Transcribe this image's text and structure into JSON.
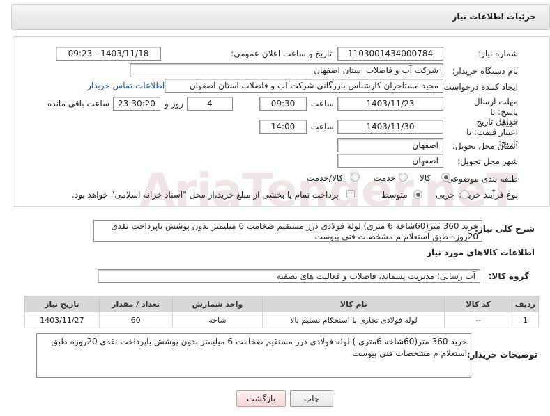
{
  "header": {
    "title": "جزئیات اطلاعات نیاز"
  },
  "watermark": "AriaTender.neT",
  "form": {
    "need_number_label": "شماره نیاز:",
    "need_number": "1103001434000784",
    "announce_label": "تاریخ و ساعت اعلان عمومی:",
    "announce_value": "1403/11/18 - 09:23",
    "buyer_org_label": "نام دستگاه خریدار:",
    "buyer_org": "شرکت آب و فاضلاب استان اصفهان",
    "creator_label": "ایجاد کننده درخواست:",
    "creator": "مجید مستاجران کارشناس بازرگانی شرکت آب و فاضلاب استان اصفهان",
    "contact_link": "اطلاعات تماس خریدار",
    "deadline_label": "مهلت ارسال پاسخ: تا تاریخ:",
    "deadline_date": "1403/11/23",
    "time_label": "ساعت",
    "deadline_time": "09:30",
    "days_value": "4",
    "days_label": "روز و",
    "remaining_time": "23:30:20",
    "remaining_label": "ساعت باقی مانده",
    "validity_label": "حداقل تاریخ اعتبار قیمت: تا تاریخ:",
    "validity_date": "1403/11/30",
    "validity_time": "14:00",
    "province_label": "استان محل تحویل:",
    "province": "اصفهان",
    "city_label": "شهر محل تحویل:",
    "city": "اصفهان",
    "category_label": "طبقه بندی موضوعی:",
    "category_options": [
      "کالا",
      "خدمت",
      "کالا/خدمت"
    ],
    "process_label": "نوع فرآیند خرید :",
    "process_options": [
      "جزیی",
      "متوسط"
    ],
    "payment_text": "پرداخت تمام یا بخشی از مبلغ خرید،از محل \"اسناد خزانه اسلامی\" خواهد بود."
  },
  "summary": {
    "label": "شرح کلی نیاز:",
    "text": "خرید 360 متر(60شاخه 6 متری) لوله فولادی درز مستقیم ضخامت 6 میلیمتر بدون پوشش باپرداخت نقدی 20روزه طبق استعلام م مشخصات فنی پیوست"
  },
  "goods": {
    "section_title": "اطلاعات کالاهای مورد نیاز",
    "group_label": "گروه کالا:",
    "group_value": "آب رسانی؛ مدیریت پسماند، فاضلاب و فعالیت های تصفیه",
    "columns": [
      "ردیف",
      "کد کالا",
      "نام کالا",
      "واحد شمارش",
      "تعداد / مقدار",
      "تاریخ نیاز"
    ],
    "rows": [
      [
        "1",
        "--",
        "لوله فولادی تجاری با استحکام تسلیم بالا",
        "شاخه",
        "60",
        "1403/11/27"
      ]
    ]
  },
  "buyer_notes": {
    "label": "توضیحات خریدار:",
    "text": "خرید 360 متر(60شاخه 6متری ) لوله فولادی درز مستقیم ضخامت 6 میلیمتر بدون پوشش باپرداخت نقدی 20روزه طبق استعلام م مشخصات فنی پیوست"
  },
  "buttons": {
    "print": "چاپ",
    "back": "بازگشت"
  }
}
